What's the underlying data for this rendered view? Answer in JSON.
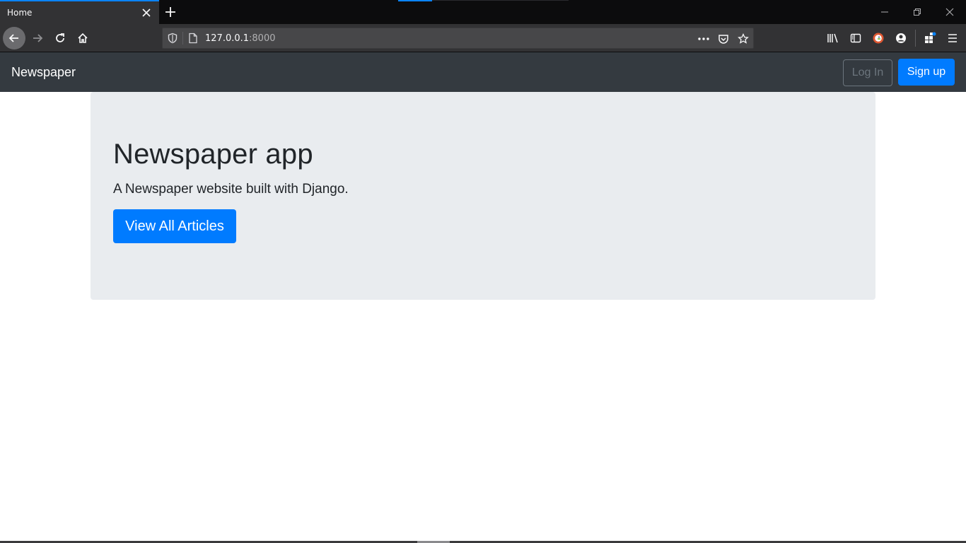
{
  "browser": {
    "tab": {
      "title": "Home"
    },
    "url": {
      "host": "127.0.0.1",
      "port": ":8000"
    }
  },
  "colors": {
    "accent": "#0a84ff",
    "site_nav_bg": "#343a40",
    "primary_button": "#007bff",
    "jumbotron_bg": "#e9ecef"
  },
  "icons": {
    "tab_close": "close-icon",
    "new_tab": "plus-icon",
    "back": "arrow-left-icon",
    "forward": "arrow-right-icon",
    "reload": "reload-icon",
    "home": "home-icon",
    "site_info": "shield-icon",
    "page": "page-icon",
    "page_actions": "more-horizontal-icon",
    "pocket": "pocket-icon",
    "bookmark": "star-icon",
    "library": "library-icon",
    "sidebar": "sidebar-icon",
    "duckduckgo": "duckduckgo-icon",
    "account": "account-icon",
    "extensions": "extensions-icon",
    "menu": "hamburger-menu-icon"
  },
  "site": {
    "brand": "Newspaper",
    "login_label": "Log In",
    "signup_label": "Sign up"
  },
  "hero": {
    "title": "Newspaper app",
    "lead": "A Newspaper website built with Django.",
    "button_label": "View All Articles"
  }
}
